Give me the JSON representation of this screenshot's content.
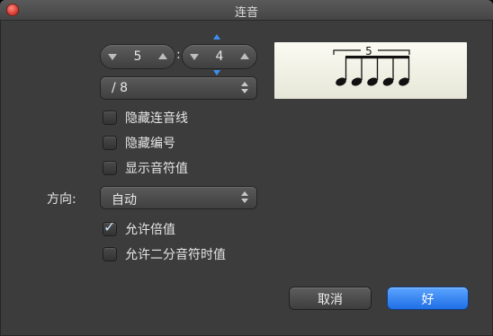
{
  "window": {
    "title": "连音"
  },
  "tuplet": {
    "numerator": "5",
    "denominator": "4",
    "unit": "/ 8"
  },
  "checkboxes": [
    {
      "label": "隐藏连音线",
      "checked": false
    },
    {
      "label": "隐藏编号",
      "checked": false
    },
    {
      "label": "显示音符值",
      "checked": false
    },
    {
      "label": "允许倍值",
      "checked": true
    },
    {
      "label": "允许二分音符时值",
      "checked": false
    }
  ],
  "direction": {
    "label": "方向:",
    "value": "自动"
  },
  "preview": {
    "number": "5"
  },
  "buttons": {
    "cancel": "取消",
    "ok": "好"
  },
  "colors": {
    "accent": "#2f7ff0",
    "window_bg": "#3c3c3c"
  },
  "icons": [
    "close-button",
    "stepper-down-icon",
    "stepper-up-icon",
    "popup-arrows-icon",
    "checkmark-icon"
  ]
}
